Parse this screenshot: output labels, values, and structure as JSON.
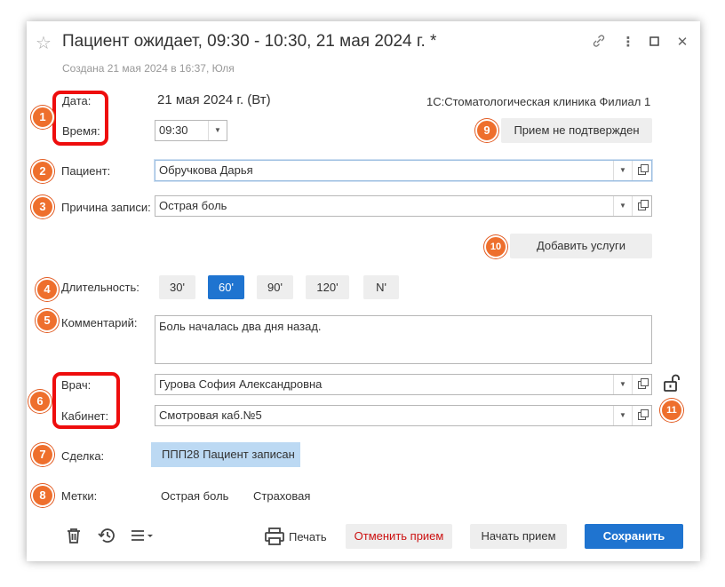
{
  "window": {
    "title": "Пациент ожидает, 09:30 - 10:30, 21 мая 2024 г. *",
    "subtitle": "Создана 21 мая 2024  в 16:37, Юля",
    "controls": [
      "link-icon",
      "more-icon",
      "maximize-icon",
      "close-icon"
    ]
  },
  "header": {
    "date_label": "Дата:",
    "date_value": "21 мая 2024 г. (Вт)",
    "clinic": "1С:Стоматологическая клиника Филиал 1",
    "time_label": "Время:",
    "time_value": "09:30",
    "confirm_button": "Прием не подтвержден"
  },
  "form": {
    "patient_label": "Пациент:",
    "patient_value": "Обручкова Дарья",
    "reason_label": "Причина записи:",
    "reason_value": "Острая боль",
    "add_services_button": "Добавить услуги",
    "duration_label": "Длительность:",
    "durations": [
      "30'",
      "60'",
      "90'",
      "120'",
      "N'"
    ],
    "duration_selected": "60'",
    "comment_label": "Комментарий:",
    "comment_value": "Боль началась два дня назад.",
    "doctor_label": "Врач:",
    "doctor_value": "Гурова София Александровна",
    "room_label": "Кабинет:",
    "room_value": "Смотровая каб.№5",
    "deal_label": "Сделка:",
    "deal_value": "ППП28  Пациент записан",
    "tags_label": "Метки:",
    "tags": [
      "Острая боль",
      "Страховая"
    ]
  },
  "footer": {
    "print_button": "Печать",
    "cancel_button": "Отменить прием",
    "start_button": "Начать прием",
    "save_button": "Сохранить"
  },
  "annotations": [
    "1",
    "2",
    "3",
    "4",
    "5",
    "6",
    "7",
    "8",
    "9",
    "10",
    "11"
  ],
  "colors": {
    "accent": "#1f74d0",
    "badge": "#ee6f2d",
    "highlight": "#ee0d0d",
    "deal_bg": "#bcd9f3",
    "cancel_text": "#cc1111"
  }
}
